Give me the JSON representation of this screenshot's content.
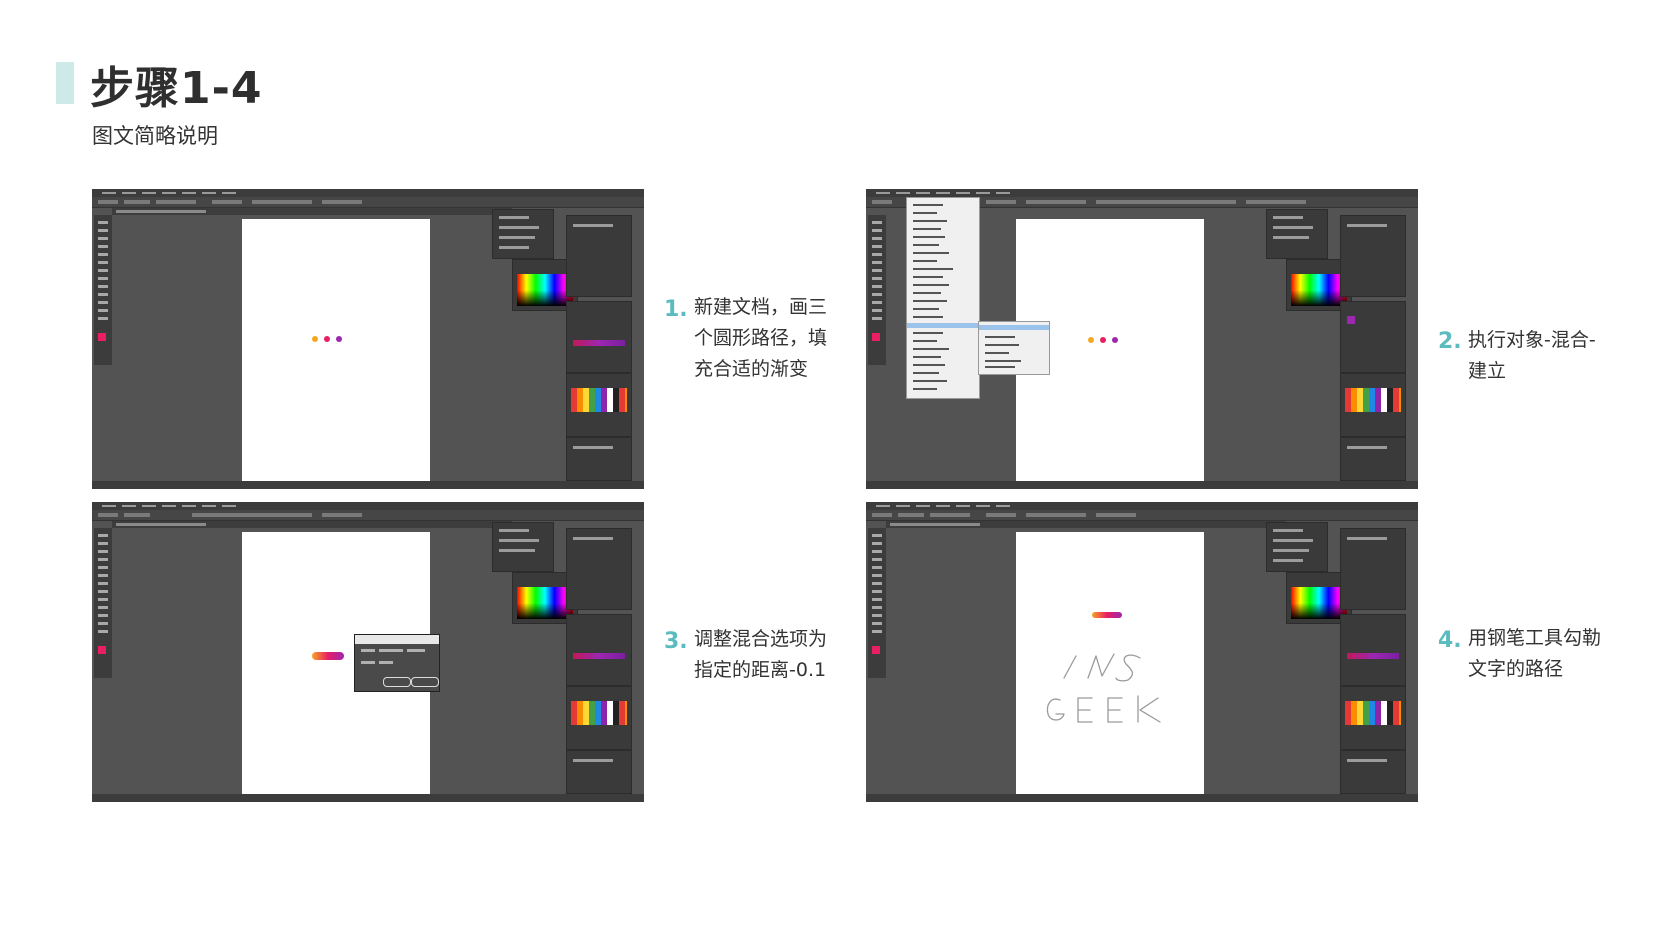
{
  "header": {
    "title": "步骤1-4",
    "subtitle": "图文简略说明"
  },
  "steps": [
    {
      "number": "1.",
      "lines": [
        "新建文档，画三",
        "个圆形路径，填",
        "充合适的渐变"
      ]
    },
    {
      "number": "2.",
      "lines": [
        "执行对象-混合-",
        "建立"
      ]
    },
    {
      "number": "3.",
      "lines": [
        "调整混合选项为",
        "指定的距离-0.1"
      ]
    },
    {
      "number": "4.",
      "lines": [
        "用钢笔工具勾勒",
        "文字的路径"
      ]
    }
  ],
  "screenshots": [
    {
      "name": "step1-illustrator-screenshot",
      "artwork": "three-gradient-circles",
      "colors": [
        "#f5a623",
        "#e91e63",
        "#9c27b0"
      ]
    },
    {
      "name": "step2-illustrator-screenshot",
      "artwork": "object-blend-make-menu",
      "colors": [
        "#f5a623",
        "#e91e63",
        "#9c27b0"
      ]
    },
    {
      "name": "step3-illustrator-screenshot",
      "artwork": "blend-options-dialog",
      "colors": [
        "#f5a623",
        "#e91e63",
        "#9c27b0"
      ]
    },
    {
      "name": "step4-illustrator-screenshot",
      "artwork": "ins-geek-pen-paths",
      "colors": [
        "#f5a623",
        "#e91e63",
        "#9c27b0"
      ]
    }
  ],
  "colors": {
    "accent": "#5bbcc0",
    "accent_bar": "#cdeae9",
    "ui_dark": "#535353"
  }
}
